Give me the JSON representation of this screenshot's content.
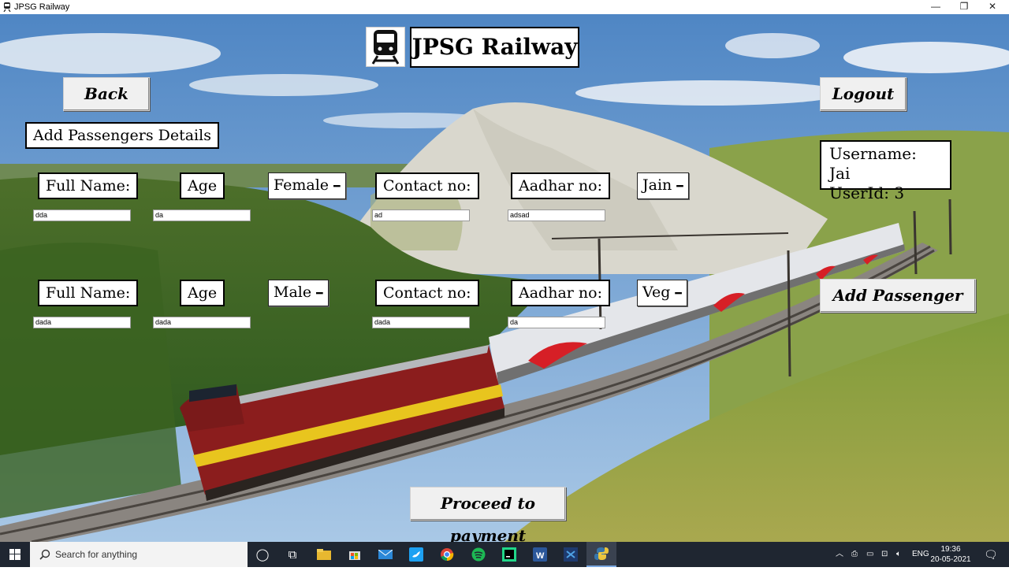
{
  "window": {
    "title": "JPSG Railway"
  },
  "header": {
    "title": "JPSG Railway"
  },
  "nav": {
    "back_label": "Back",
    "logout_label": "Logout"
  },
  "section": {
    "title": "Add Passengers Details"
  },
  "user": {
    "username": "Username: Jai",
    "userid": "UserId: 3"
  },
  "passengers": [
    {
      "fullname_label": "Full Name:",
      "fullname_value": "dda",
      "age_label": "Age",
      "age_value": "da",
      "gender": "Female",
      "contact_label": "Contact no:",
      "contact_value": "ad",
      "aadhar_label": "Aadhar no:",
      "aadhar_value": "adsad",
      "food": "Jain"
    },
    {
      "fullname_label": "Full Name:",
      "fullname_value": "dada",
      "age_label": "Age",
      "age_value": "dada",
      "gender": "Male",
      "contact_label": "Contact no:",
      "contact_value": "dada",
      "aadhar_label": "Aadhar no:",
      "aadhar_value": "da",
      "food": "Veg"
    }
  ],
  "actions": {
    "add_passenger_label": "Add Passenger",
    "proceed_label": "Proceed to payment"
  },
  "taskbar": {
    "search_placeholder": "Search for anything",
    "language": "ENG",
    "time": "19:36",
    "date": "20-05-2021"
  },
  "colors": {
    "sky": "#6f9fd0",
    "grass": "#6b8a2e",
    "hill": "#d8d6cc",
    "locomotive": "#8b1d1d",
    "taskbar": "#1f2631"
  },
  "icons": [
    "train-icon",
    "windows-start-icon",
    "search-icon",
    "cortana-icon",
    "task-view-icon",
    "file-explorer-icon",
    "store-icon",
    "mail-icon",
    "twitter-icon",
    "chrome-icon",
    "spotify-icon",
    "pycharm-icon",
    "word-icon",
    "vscode-icon",
    "python-icon",
    "notifications-icon"
  ]
}
